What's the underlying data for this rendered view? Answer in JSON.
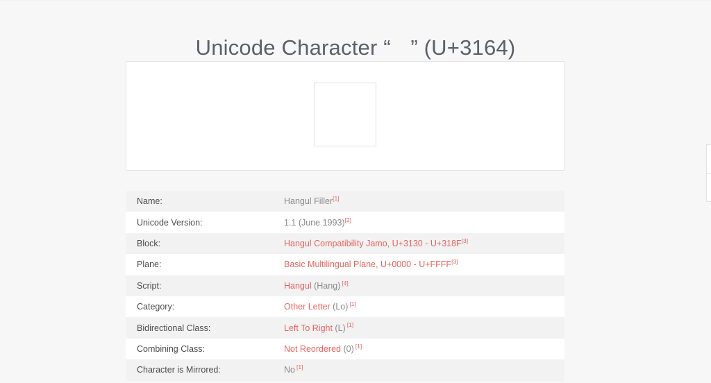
{
  "page": {
    "title_prefix": "Unicode Character ",
    "title_open_quote": "“",
    "title_char": "ㅤ",
    "title_close_quote": "”",
    "title_codepoint": " (U+3164)",
    "title_full": "Unicode Character “ㅤ” (U+3164)",
    "accent_color": "#e8645f",
    "title_color": "#5a6169",
    "background_color": "#f7f7f8"
  },
  "glyph_preview": {
    "character": "ㅤ",
    "note": "invisible glyph rendered as empty box"
  },
  "properties": [
    {
      "label": "Name:",
      "value_link": "",
      "value_plain": "Hangul Filler",
      "footnote": "[1]",
      "footnote_spaced": false
    },
    {
      "label": "Unicode Version:",
      "value_link": "",
      "value_plain": "1.1 (June 1993)",
      "footnote": "[2]",
      "footnote_spaced": false
    },
    {
      "label": "Block:",
      "value_link": "Hangul Compatibility Jamo, U+3130 - U+318F",
      "value_plain": "",
      "footnote": "[3]",
      "footnote_spaced": false
    },
    {
      "label": "Plane:",
      "value_link": "Basic Multilingual Plane, U+0000 - U+FFFF",
      "value_plain": "",
      "footnote": "[3]",
      "footnote_spaced": false
    },
    {
      "label": "Script:",
      "value_link": "Hangul",
      "value_plain": " (Hang)",
      "footnote": "[4]",
      "footnote_spaced": true
    },
    {
      "label": "Category:",
      "value_link": "Other Letter",
      "value_plain": " (Lo)",
      "footnote": "[1]",
      "footnote_spaced": true
    },
    {
      "label": "Bidirectional Class:",
      "value_link": "Left To Right",
      "value_plain": " (L)",
      "footnote": "[1]",
      "footnote_spaced": true
    },
    {
      "label": "Combining Class:",
      "value_link": "Not Reordered",
      "value_plain": " (0)",
      "footnote": "[1]",
      "footnote_spaced": true
    },
    {
      "label": "Character is Mirrored:",
      "value_link": "",
      "value_plain": "No",
      "footnote": "[1]",
      "footnote_spaced": true
    }
  ]
}
